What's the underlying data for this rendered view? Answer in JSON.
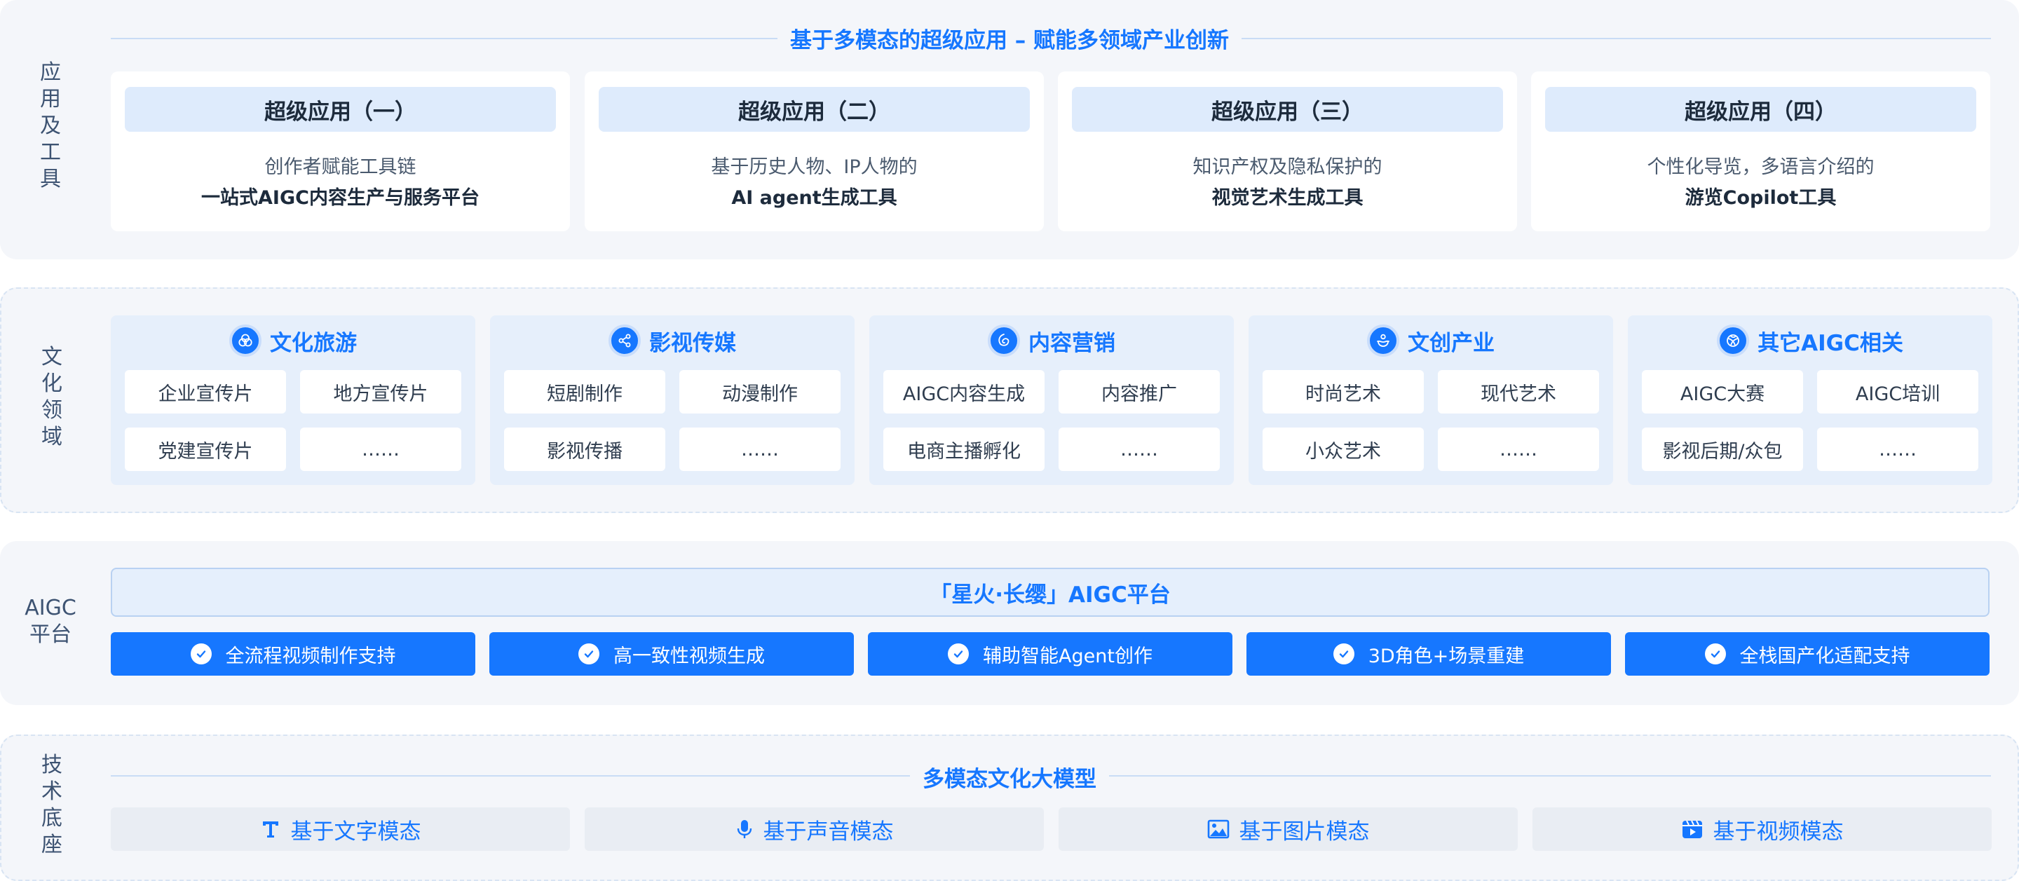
{
  "apps": {
    "side_label": [
      "应",
      "用",
      "及",
      "工",
      "具"
    ],
    "banner": "基于多模态的超级应用 – 赋能多领域产业创新",
    "cards": [
      {
        "title": "超级应用（一）",
        "line1": "创作者赋能工具链",
        "line2": "一站式AIGC内容生产与服务平台"
      },
      {
        "title": "超级应用（二）",
        "line1": "基于历史人物、IP人物的",
        "line2": "AI agent生成工具"
      },
      {
        "title": "超级应用（三）",
        "line1": "知识产权及隐私保护的",
        "line2": "视觉艺术生成工具"
      },
      {
        "title": "超级应用（四）",
        "line1": "个性化导览，多语言介绍的",
        "line2": "游览Copilot工具"
      }
    ]
  },
  "culture": {
    "side_label": [
      "文",
      "化",
      "领",
      "域"
    ],
    "domains": [
      {
        "title": "文化旅游",
        "icon": "circles-icon",
        "items": [
          "企业宣传片",
          "地方宣传片",
          "党建宣传片",
          "……"
        ]
      },
      {
        "title": "影视传媒",
        "icon": "share-icon",
        "items": [
          "短剧制作",
          "动漫制作",
          "影视传播",
          "……"
        ]
      },
      {
        "title": "内容营销",
        "icon": "spiral-icon",
        "items": [
          "AIGC内容生成",
          "内容推广",
          "电商主播孵化",
          "……"
        ]
      },
      {
        "title": "文创产业",
        "icon": "hand-icon",
        "items": [
          "时尚艺术",
          "现代艺术",
          "小众艺术",
          "……"
        ]
      },
      {
        "title": "其它AIGC相关",
        "icon": "ball-icon",
        "items": [
          "AIGC大赛",
          "AIGC培训",
          "影视后期/众包",
          "……"
        ]
      }
    ]
  },
  "aigc": {
    "side_label": [
      "AIGC",
      "平台"
    ],
    "platform": "「星火·长缨」AIGC平台",
    "features": [
      "全流程视频制作支持",
      "高一致性视频生成",
      "辅助智能Agent创作",
      "3D角色+场景重建",
      "全栈国产化适配支持"
    ]
  },
  "tech": {
    "side_label": [
      "技",
      "术",
      "底",
      "座"
    ],
    "title": "多模态文化大模型",
    "modalities": [
      {
        "label": "基于文字模态",
        "icon": "text-icon"
      },
      {
        "label": "基于声音模态",
        "icon": "microphone-icon"
      },
      {
        "label": "基于图片模态",
        "icon": "image-icon"
      },
      {
        "label": "基于视频模态",
        "icon": "video-icon"
      }
    ]
  },
  "colors": {
    "accent": "#1677ff",
    "panel": "#f4f6fa",
    "card_head": "#deebfc",
    "domain_bg": "#e6effb"
  }
}
